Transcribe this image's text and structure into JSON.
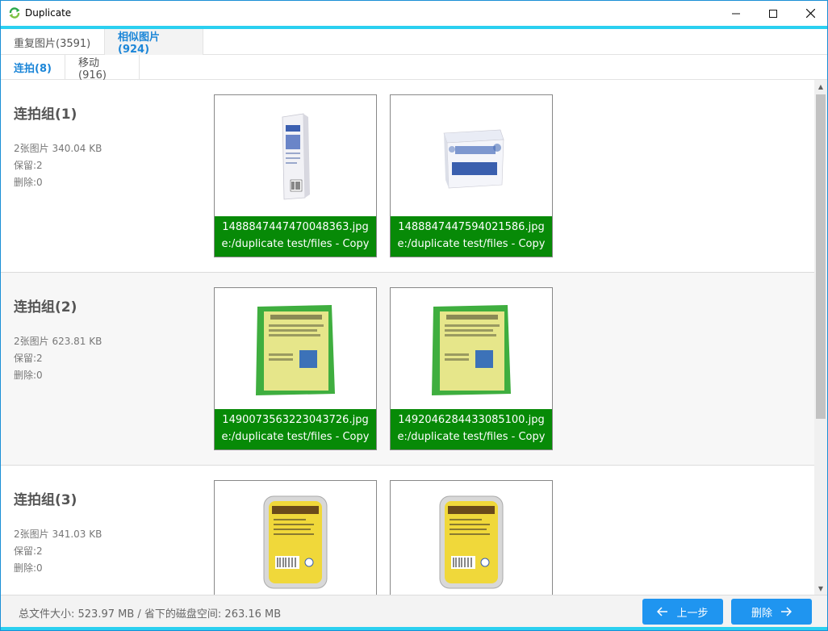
{
  "window": {
    "title": "Duplicate"
  },
  "tabs_top": [
    {
      "label": "重复图片(3591)"
    },
    {
      "label": "相似图片(924)"
    }
  ],
  "tabs_sub": [
    {
      "label": "连拍(8)"
    },
    {
      "label": "移动(916)"
    }
  ],
  "groups": [
    {
      "title": "连拍组(1)",
      "summary": "2张图片 340.04 KB",
      "keep": "保留:2",
      "delete": "删除:0",
      "images": [
        {
          "name": "1488847447470048363.jpg",
          "path": "e:/duplicate test/files - Copy"
        },
        {
          "name": "1488847447594021586.jpg",
          "path": "e:/duplicate test/files - Copy"
        }
      ]
    },
    {
      "title": "连拍组(2)",
      "summary": "2张图片 623.81 KB",
      "keep": "保留:2",
      "delete": "删除:0",
      "images": [
        {
          "name": "1490073563223043726.jpg",
          "path": "e:/duplicate test/files - Copy"
        },
        {
          "name": "1492046284433085100.jpg",
          "path": "e:/duplicate test/files - Copy"
        }
      ]
    },
    {
      "title": "连拍组(3)",
      "summary": "2张图片 341.03 KB",
      "keep": "保留:2",
      "delete": "删除:0",
      "images": [
        {
          "name": "",
          "path": ""
        },
        {
          "name": "",
          "path": ""
        }
      ]
    }
  ],
  "footer": {
    "summary": "总文件大小: 523.97 MB / 省下的磁盘空间: 263.16 MB",
    "prev_label": "上一步",
    "delete_label": "删除"
  },
  "colors": {
    "accent": "#2bd0f0",
    "tab_active": "#1c86d8",
    "caption_bg": "#078a07",
    "button": "#1f95f0"
  },
  "icons": {
    "app": "duplicate-app-icon",
    "prev": "arrow-left-icon",
    "next": "arrow-right-icon"
  }
}
